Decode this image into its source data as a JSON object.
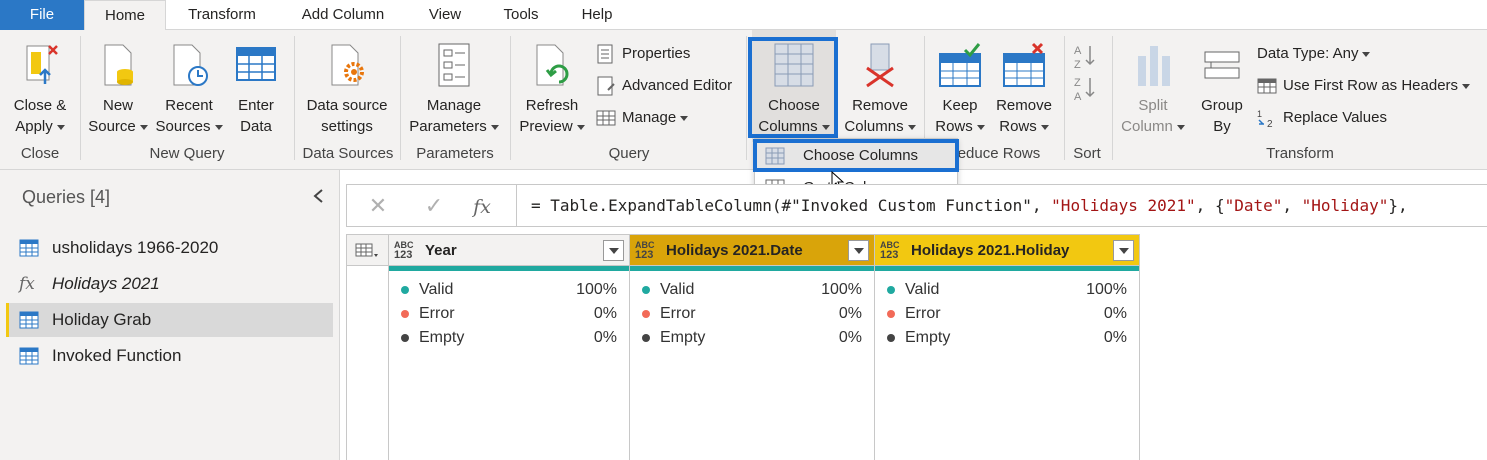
{
  "menu": {
    "tabs": [
      "File",
      "Home",
      "Transform",
      "Add Column",
      "View",
      "Tools",
      "Help"
    ]
  },
  "ribbon": {
    "close": {
      "line1": "Close &",
      "line2": "Apply",
      "group": "Close"
    },
    "new_query": {
      "new_source": {
        "line1": "New",
        "line2": "Source"
      },
      "recent_sources": {
        "line1": "Recent",
        "line2": "Sources"
      },
      "enter_data": {
        "line1": "Enter",
        "line2": "Data"
      },
      "group": "New Query"
    },
    "data_sources": {
      "line1": "Data source",
      "line2": "settings",
      "group": "Data Sources"
    },
    "parameters": {
      "line1": "Manage",
      "line2": "Parameters",
      "group": "Parameters"
    },
    "query": {
      "refresh": {
        "line1": "Refresh",
        "line2": "Preview"
      },
      "properties": "Properties",
      "advanced_editor": "Advanced Editor",
      "manage": "Manage",
      "group": "Query"
    },
    "manage_columns": {
      "choose": {
        "line1": "Choose",
        "line2": "Columns"
      },
      "remove": {
        "line1": "Remove",
        "line2": "Columns"
      }
    },
    "reduce_rows": {
      "keep": {
        "line1": "Keep",
        "line2": "Rows"
      },
      "remove": {
        "line1": "Remove",
        "line2": "Rows"
      },
      "group_partial": "educe Rows"
    },
    "sort": {
      "group": "Sort",
      "az": "A↓Z",
      "za": "Z↓A"
    },
    "transform": {
      "split": {
        "line1": "Split",
        "line2": "Column"
      },
      "group_by": {
        "line1": "Group",
        "line2": "By"
      },
      "data_type": "Data Type: Any",
      "first_row": "Use First Row as Headers",
      "replace": "Replace Values",
      "group": "Transform"
    }
  },
  "dropdown": {
    "items": [
      "Choose Columns",
      "Go to Column"
    ]
  },
  "queries": {
    "title": "Queries [4]",
    "items": [
      "usholidays 1966-2020",
      "Holidays 2021",
      "Holiday Grab",
      "Invoked Function"
    ],
    "selected": "Holiday Grab"
  },
  "formula_bar": {
    "fx": "fx",
    "prefix": "= Table.ExpandTableColumn(#\"Invoked Custom Function\", ",
    "arg1": "\"Holidays 2021\"",
    "mid": ", {",
    "arg2": "\"Date\"",
    "comma": ", ",
    "arg3": "\"Holiday\"",
    "suffix": "},"
  },
  "grid": {
    "type_label_top": "ABC",
    "type_label_bottom": "123",
    "columns": [
      {
        "name": "Year",
        "valid": "100%",
        "error": "0%",
        "empty": "0%",
        "header_color": "#f3f2f1"
      },
      {
        "name": "Holidays 2021.Date",
        "valid": "100%",
        "error": "0%",
        "empty": "0%",
        "header_color": "#d9a40a"
      },
      {
        "name": "Holidays 2021.Holiday",
        "valid": "100%",
        "error": "0%",
        "empty": "0%",
        "header_color": "#f2c811"
      }
    ],
    "labels": {
      "valid": "Valid",
      "error": "Error",
      "empty": "Empty"
    },
    "colors": {
      "valid": "#20a9a0",
      "error": "#f26a58",
      "empty": "#444444"
    }
  },
  "colors": {
    "accent": "#2b78c6",
    "highlight": "#1a6fd1",
    "selected_query_bar": "#f2c811"
  }
}
